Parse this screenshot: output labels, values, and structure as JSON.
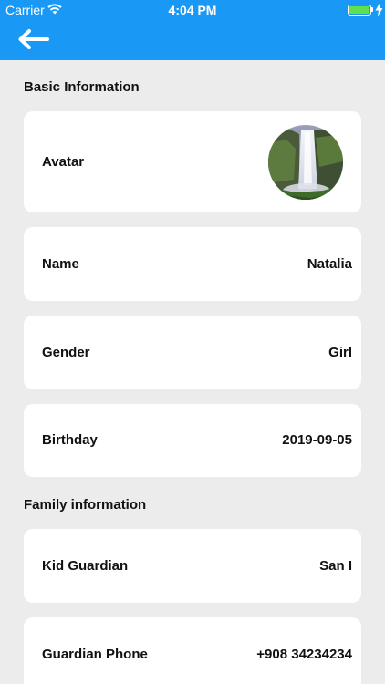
{
  "status_bar": {
    "carrier": "Carrier",
    "time": "4:04 PM",
    "battery_level": 1.0,
    "charging": true
  },
  "nav": {
    "back_icon": "arrow-left-icon",
    "color": "#1a98f5"
  },
  "basic_section": {
    "title": "Basic Information",
    "avatar_label": "Avatar",
    "rows": [
      {
        "label": "Name",
        "value": "Natalia"
      },
      {
        "label": "Gender",
        "value": "Girl"
      },
      {
        "label": "Birthday",
        "value": "2019-09-05"
      }
    ]
  },
  "family_section": {
    "title": "Family information",
    "rows": [
      {
        "label": "Kid Guardian",
        "value": "San I"
      },
      {
        "label": "Guardian Phone",
        "value": "+908 34234234"
      }
    ]
  }
}
